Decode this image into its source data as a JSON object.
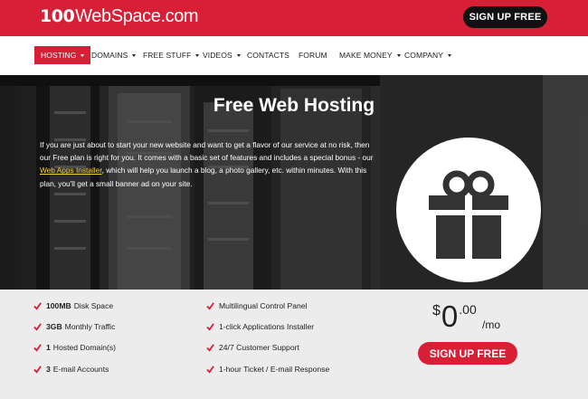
{
  "brand": {
    "logo_number": "100",
    "logo_text": "WebSpace.com",
    "accent_color": "#d71f35"
  },
  "header": {
    "signup_label": "SIGN UP FREE"
  },
  "nav": {
    "items": [
      {
        "label": "HOSTING",
        "dropdown": true,
        "active": true
      },
      {
        "label": "DOMAINS",
        "dropdown": true
      },
      {
        "label": "FREE STUFF",
        "dropdown": true
      },
      {
        "label": "VIDEOS",
        "dropdown": true
      },
      {
        "label": "CONTACTS",
        "dropdown": false
      },
      {
        "label": "FORUM",
        "dropdown": false
      },
      {
        "label": "MAKE MONEY",
        "dropdown": true
      },
      {
        "label": "COMPANY",
        "dropdown": true
      }
    ]
  },
  "hero": {
    "title": "Free Web Hosting",
    "text_before_link": "If you are just about to start your new website and want to get a flavor of our service at no risk, then our Free plan is right for you. It comes with a basic set of features and includes a special bonus - our ",
    "link_text": "Web Apps Installer",
    "text_after_link": ", which will help you launch a blog, a photo gallery, etc. within minutes. With this plan, you'll get a small banner ad on your site.",
    "icon": "gift-icon"
  },
  "features": {
    "left": [
      {
        "strong": "100MB",
        "rest": "Disk Space"
      },
      {
        "strong": "3GB",
        "rest": "Monthly Traffic"
      },
      {
        "strong": "1",
        "rest": "Hosted Domain(s)"
      },
      {
        "strong": "3",
        "rest": "E-mail Accounts"
      }
    ],
    "right": [
      "Multilingual Control Panel",
      "1-click Applications Installer",
      "24/7 Customer Support",
      "1-hour Ticket / E-mail Response"
    ]
  },
  "pricing": {
    "currency": "$",
    "amount": "0",
    "decimals": ".00",
    "period": "/mo",
    "signup_label": "SIGN UP FREE"
  }
}
